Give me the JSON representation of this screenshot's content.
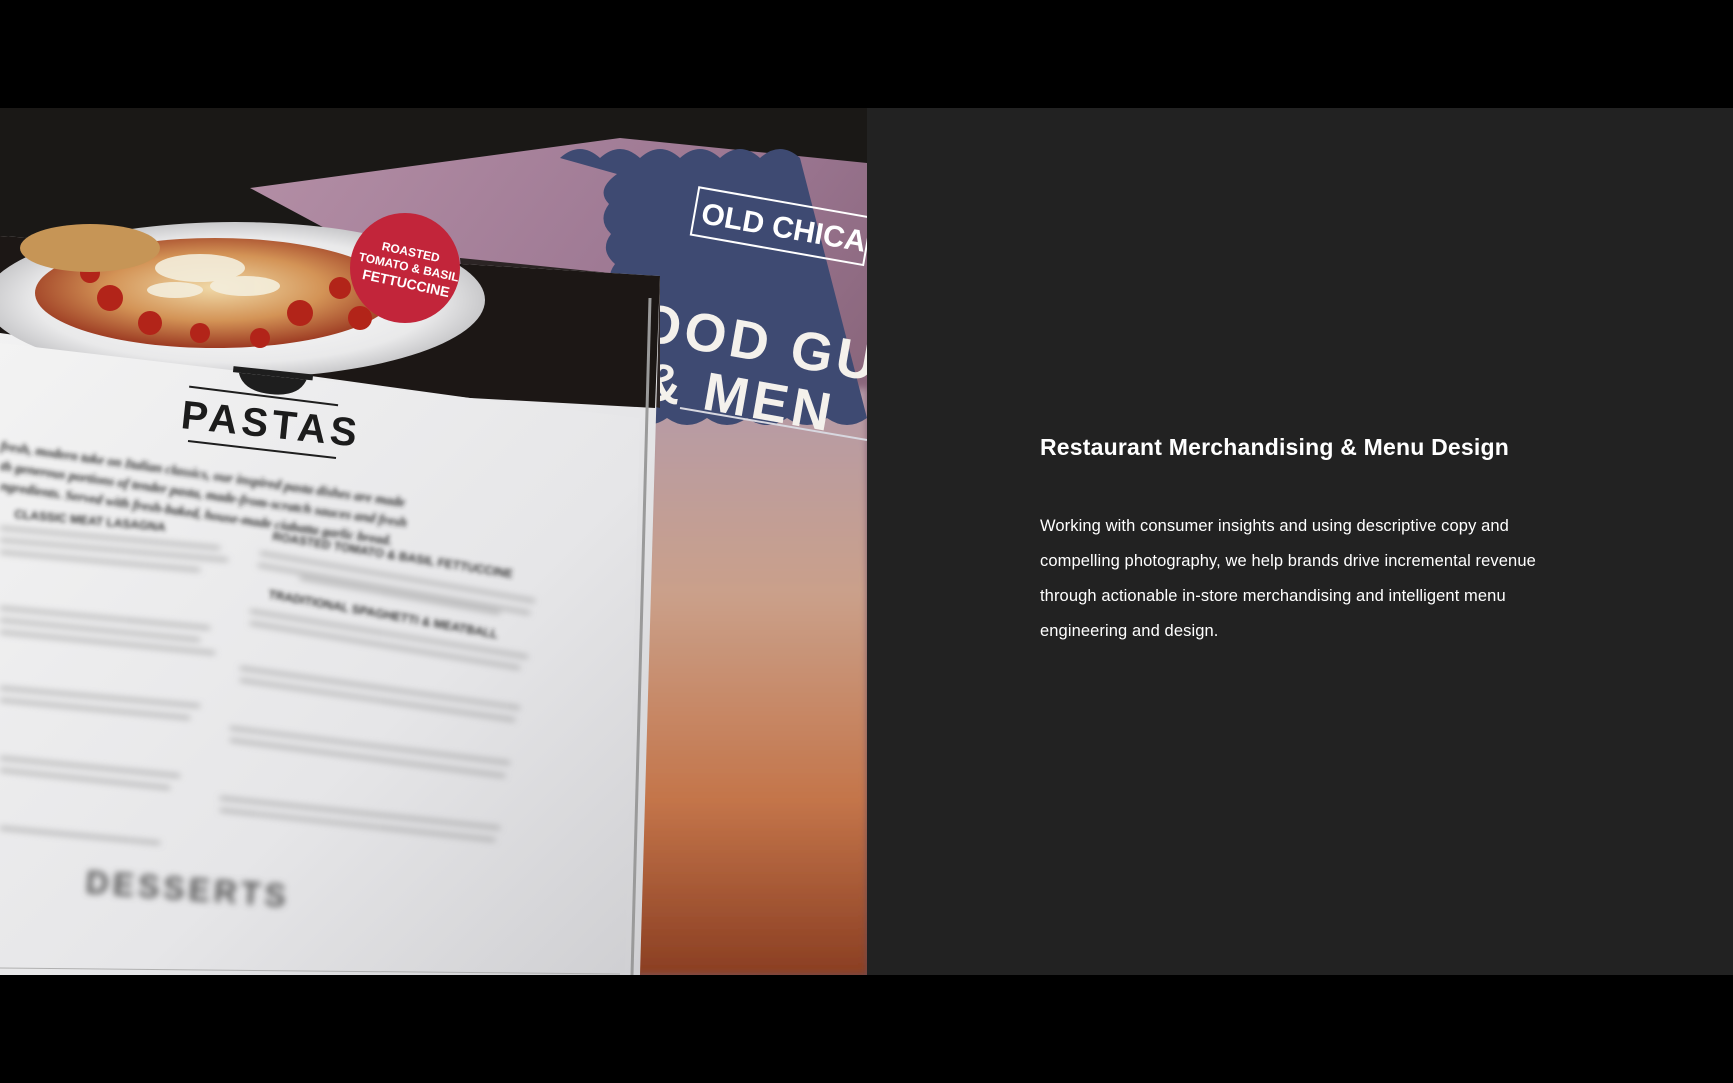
{
  "slide": {
    "title": "Restaurant Merchandising & Menu Design",
    "body": "Working with consumer insights and using descriptive copy and compelling photography, we help brands drive incremental revenue through actionable in-store merchandising and intelligent menu engineering and design."
  },
  "photo": {
    "badge_text": [
      "ROASTED",
      "TOMATO & BASIL",
      "FETTUCCINE"
    ],
    "brand_text": "OLD CHICA",
    "cover_line_1": "FOOD GU",
    "cover_line_2": "& MEN",
    "menu_heading": "PASTAS",
    "menu_intro": [
      "fresh, modern take on Italian classics, our inspired pasta dishes are made",
      "th generous portions of tender pasta, made-from-scratch sauces and fresh",
      "ngredients. Served with fresh-baked, house-made ciabatta garlic bread."
    ],
    "menu_items": [
      "CLASSIC MEAT LASAGNA",
      "ROASTED TOMATO & BASIL FETTUCCINE",
      "TRADITIONAL SPAGHETTI & MEATBALL"
    ],
    "menu_footer": "DESSERTS"
  },
  "colors": {
    "background": "#000000",
    "panel": "#222222",
    "text": "#ffffff",
    "cover_blue": "#3e4a72",
    "badge_red": "#c2253a"
  }
}
